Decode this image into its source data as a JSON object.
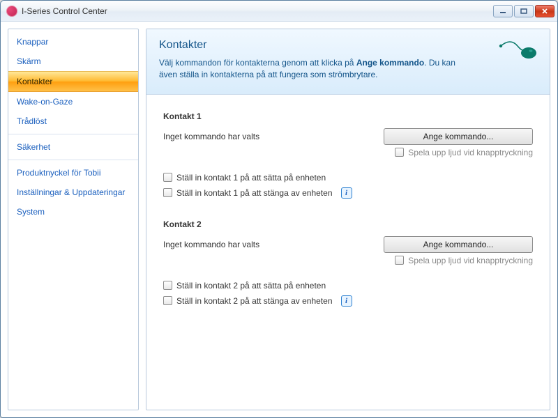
{
  "window": {
    "title": "I-Series Control Center"
  },
  "sidebar": {
    "items": [
      {
        "label": "Knappar"
      },
      {
        "label": "Skärm"
      },
      {
        "label": "Kontakter",
        "selected": true
      },
      {
        "label": "Wake-on-Gaze"
      },
      {
        "label": "Trådlöst"
      },
      {
        "label": "Säkerhet"
      },
      {
        "label": "Produktnyckel för Tobii"
      },
      {
        "label": "Inställningar & Uppdateringar"
      },
      {
        "label": "System"
      }
    ]
  },
  "banner": {
    "heading": "Kontakter",
    "text_before": "Välj kommandon för kontakterna genom att klicka på ",
    "text_bold": "Ange kommando",
    "text_after": ". Du kan även ställa in kontakterna på att fungera som strömbrytare."
  },
  "contacts": [
    {
      "title": "Kontakt 1",
      "status": "Inget kommando har valts",
      "button": "Ange kommando...",
      "sound_label": "Spela upp ljud vid knapptryckning",
      "opt_on": "Ställ in kontakt 1 på att sätta på enheten",
      "opt_off": "Ställ in kontakt 1 på att stänga av enheten"
    },
    {
      "title": "Kontakt 2",
      "status": "Inget kommando har valts",
      "button": "Ange kommando...",
      "sound_label": "Spela upp ljud vid knapptryckning",
      "opt_on": "Ställ in kontakt 2 på att sätta på enheten",
      "opt_off": "Ställ in kontakt 2 på att stänga av enheten"
    }
  ],
  "colors": {
    "accent": "#1a5fbe",
    "banner_bg_top": "#f0f8ff",
    "banner_bg_bot": "#d9ecfb",
    "selected_grad": "#ffb930",
    "teal": "#0b7a6a"
  }
}
